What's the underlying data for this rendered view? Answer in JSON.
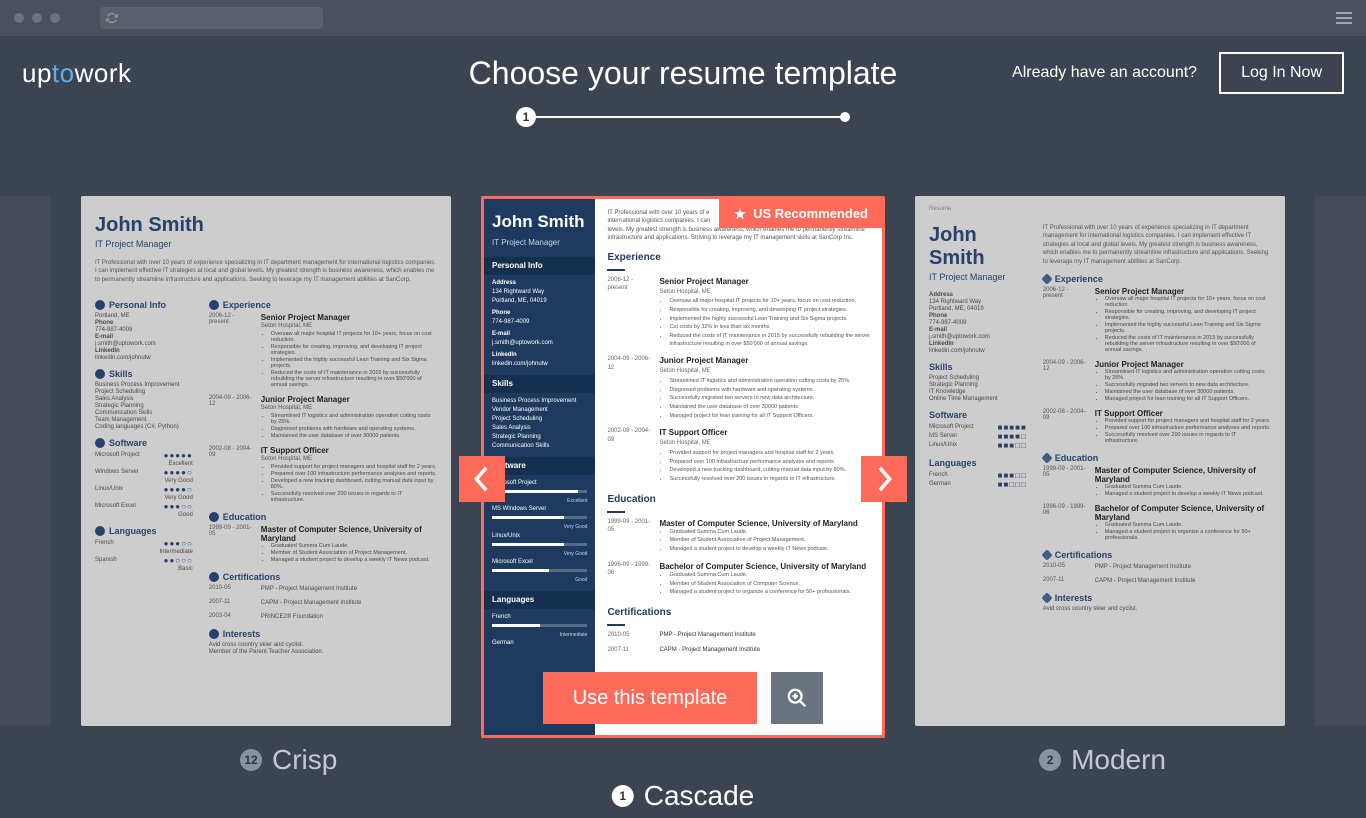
{
  "logo": {
    "p1": "up",
    "p2": "to",
    "p3": "work"
  },
  "page_title": "Choose your resume template",
  "account": {
    "question": "Already have an account?",
    "login": "Log In Now"
  },
  "progress": {
    "step1": "1"
  },
  "badge": "US Recommended",
  "use_button": "Use this template",
  "nav": {
    "prev": "‹",
    "next": "›"
  },
  "templates": {
    "left": {
      "num": "12",
      "name": "Crisp"
    },
    "center": {
      "num": "1",
      "name": "Cascade"
    },
    "right": {
      "num": "2",
      "name": "Modern"
    }
  },
  "resume": {
    "name": "John Smith",
    "role": "IT Project Manager",
    "summary_short": "IT Professional with over 10 years of e",
    "summary_more": "international logistics companies. I can",
    "summary_rest": "levels. My greatest strength is business awareness, which enables me to permanently streamline infrastructure and applications. Striving to leverage my IT management skills at SanCorp Inc.",
    "summary_full": "IT Professional with over 10 years of experience specializing in IT department management for international logistics companies. I can implement effective IT strategies at local and global levels. My greatest strength is business awareness, which enables me to permanently streamline infrastructure and applications. Seeking to leverage my IT management abilities at SanCorp.",
    "personal": {
      "heading": "Personal Info",
      "addr_label": "Address",
      "addr1": "134 Rightward Way",
      "addr2": "Portland, ME, 04019",
      "phone_label": "Phone",
      "phone": "774-987-4009",
      "email_label": "E-mail",
      "email": "j.smith@uptowork.com",
      "linkedin_label": "LinkedIn",
      "linkedin": "linkedin.com/johnutw"
    },
    "skills": {
      "heading": "Skills",
      "items": [
        "Business Process Improvement",
        "Vendor Management",
        "Project Scheduling",
        "Sales Analysis",
        "Strategic Planning",
        "Communication Skills"
      ]
    },
    "software": {
      "heading": "Software",
      "items": [
        {
          "name": "Microsoft Project",
          "rating": "Excellent"
        },
        {
          "name": "MS Windows Server",
          "rating": "Very Good"
        },
        {
          "name": "Linux/Unix",
          "rating": "Very Good"
        },
        {
          "name": "Microsoft Excel",
          "rating": "Good"
        }
      ]
    },
    "languages": {
      "heading": "Languages",
      "items": [
        {
          "name": "French",
          "rating": "Intermediate"
        },
        {
          "name": "German",
          "rating": ""
        }
      ]
    },
    "experience": {
      "heading": "Experience",
      "jobs": [
        {
          "dates": "2006-12 - present",
          "title": "Senior Project Manager",
          "company": "Seton Hospital, ME",
          "bullets": [
            "Oversaw all major hospital IT projects for 10+ years, focus on cost reduction.",
            "Responsible for creating, improving, and developing IT project strategies.",
            "Implemented the highly successful Lean Training and Six Sigma projects.",
            "Cut costs by 32% in less than six months.",
            "Reduced the costs of IT maintenance in 2015 by successfully rebuilding the server infrastructure resulting in over $50'000 of annual savings."
          ]
        },
        {
          "dates": "2004-09 - 2006-12",
          "title": "Junior Project Manager",
          "company": "Seton Hospital, ME",
          "bullets": [
            "Streamlined IT logistics and administration operation cutting costs by 25%.",
            "Diagnosed problems with hardware and operating systems.",
            "Successfully migrated two servers to new data architecture.",
            "Maintained the user database of over 30000 patients.",
            "Managed project for lean training for all IT Support Officers."
          ]
        },
        {
          "dates": "2002-08 - 2004-09",
          "title": "IT Support Officer",
          "company": "Seton Hospital, ME",
          "bullets": [
            "Provided support for project managers and hospital staff for 2 years.",
            "Prepared over 100 infrastructure performance analyses and reports.",
            "Developed a new tracking dashboard, cutting manual data input by 80%.",
            "Successfully resolved over 200 issues in regards to IT infrastructure."
          ]
        }
      ]
    },
    "education": {
      "heading": "Education",
      "items": [
        {
          "dates": "1999-09 - 2001-05",
          "title": "Master of Computer Science, University of Maryland",
          "bullets": [
            "Graduated Summa Cum Laude.",
            "Member of Student Association of Project Management.",
            "Managed a student project to develop a weekly IT News podcast."
          ]
        },
        {
          "dates": "1996-09 - 1999-06",
          "title": "Bachelor of Computer Science, University of Maryland",
          "bullets": [
            "Graduated Summa Cum Laude.",
            "Member of Student Association of Computer Science.",
            "Managed a student project to organize a conference for 50+ professionals."
          ]
        }
      ]
    },
    "certs": {
      "heading": "Certifications",
      "items": [
        {
          "dates": "2010-05",
          "title": "PMP - Project Management Institute"
        },
        {
          "dates": "2007-11",
          "title": "CAPM - Project Management Institute"
        },
        {
          "dates": "2003-04",
          "title": "PRINCE2® Foundation"
        }
      ]
    },
    "interests": {
      "heading": "Interests",
      "line1": "Avid cross country skier and cyclist.",
      "line2": "Member of the Parent Teacher Association."
    }
  },
  "side_sections": {
    "personal": "Personal Info",
    "skills": "Skills",
    "software": "Software",
    "languages": "Languages",
    "experience": "Experience",
    "education": "Education",
    "certs": "Certifications",
    "interests": "Interests"
  },
  "simple_personal": {
    "city": "Portland, ME",
    "phone_label": "Phone",
    "phone": "774-987-4009",
    "email_label": "E-mail",
    "email": "j.smith@uptowork.com",
    "linkedin_label": "LinkedIn",
    "linkedin": "linkedin.com/johnutw"
  },
  "simple_skills": [
    "Business Process Improvement",
    "Project Scheduling",
    "Sales Analysis",
    "Strategic Planning",
    "Communication Skills",
    "Team Management",
    "Coding languages (C#, Python)"
  ],
  "simple_soft": [
    {
      "n": "Microsoft Project",
      "r": "Excellent"
    },
    {
      "n": "Windows Server",
      "r": "Very Good"
    },
    {
      "n": "Linux/Unix",
      "r": "Very Good"
    },
    {
      "n": "Microsoft Excel",
      "r": "Good"
    }
  ],
  "simple_lang": [
    {
      "n": "French",
      "r": "Intermediate"
    },
    {
      "n": "Spanish",
      "r": "Basic"
    }
  ],
  "modern_sections": [
    "Experience",
    "Education",
    "Certifications",
    "Interests"
  ],
  "modern_extra": [
    "Project Scheduling",
    "Strategic Planning",
    "IT Knowledge",
    "Online Time Management"
  ],
  "modern_soft": [
    "Microsoft Project",
    "MS Server",
    "Linux/Unix"
  ],
  "modern_lang": [
    "French",
    "German"
  ],
  "modern_toplabel": "Resume"
}
